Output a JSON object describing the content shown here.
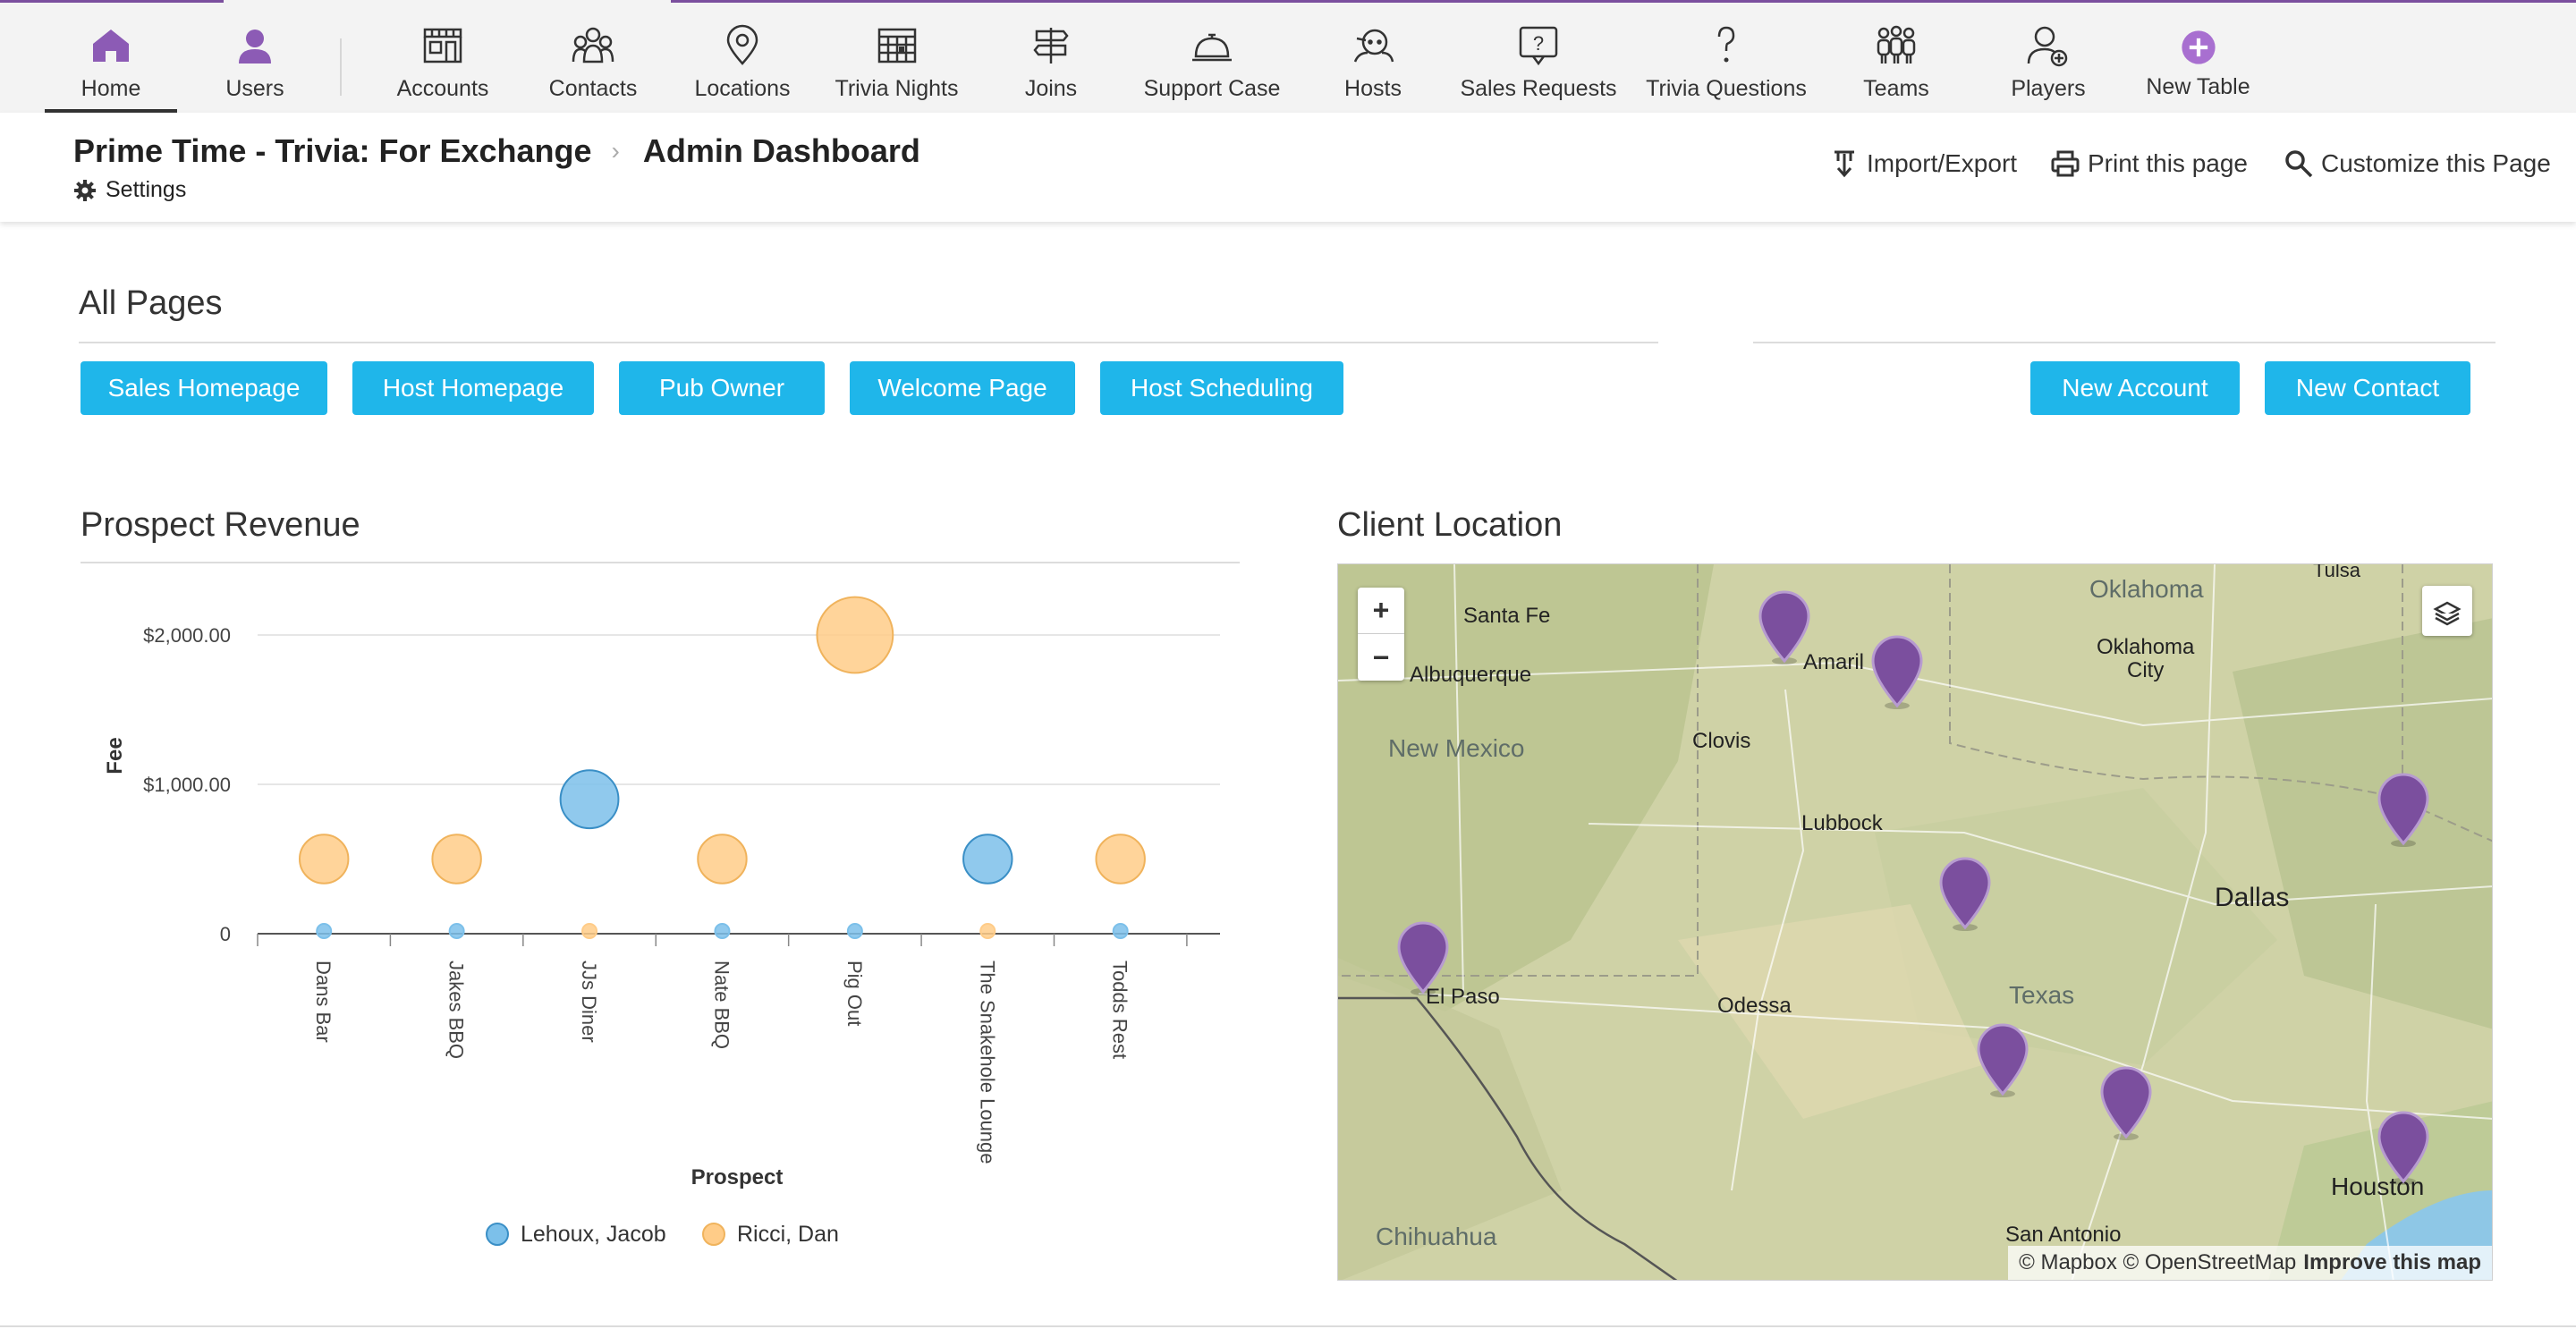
{
  "nav": {
    "items": [
      {
        "label": "Home",
        "icon": "house-icon"
      },
      {
        "label": "Users",
        "icon": "user-icon"
      },
      {
        "label": "Accounts",
        "icon": "storefront-icon"
      },
      {
        "label": "Contacts",
        "icon": "people-icon"
      },
      {
        "label": "Locations",
        "icon": "location-pin-icon"
      },
      {
        "label": "Trivia Nights",
        "icon": "calendar-icon"
      },
      {
        "label": "Joins",
        "icon": "signpost-icon"
      },
      {
        "label": "Support Case",
        "icon": "service-bell-icon"
      },
      {
        "label": "Hosts",
        "icon": "host-face-icon"
      },
      {
        "label": "Sales Requests",
        "icon": "question-bubble-icon"
      },
      {
        "label": "Trivia Questions",
        "icon": "question-mark-icon"
      },
      {
        "label": "Teams",
        "icon": "team-icon"
      },
      {
        "label": "Players",
        "icon": "player-add-icon"
      },
      {
        "label": "New Table",
        "icon": "plus-circle-icon"
      }
    ],
    "accent": "#7b4f9e"
  },
  "header": {
    "app_name": "Prime Time - Trivia: For Exchange",
    "page_name": "Admin Dashboard",
    "settings_label": "Settings",
    "actions": {
      "import_export": "Import/Export",
      "print": "Print this page",
      "customize": "Customize this Page"
    }
  },
  "all_pages": {
    "title": "All Pages",
    "buttons": [
      "Sales Homepage",
      "Host Homepage",
      "Pub Owner",
      "Welcome Page",
      "Host Scheduling"
    ],
    "right_buttons": [
      "New Account",
      "New Contact"
    ],
    "button_color": "#1fb6ea"
  },
  "revenue": {
    "title": "Prospect Revenue"
  },
  "chart_data": {
    "type": "scatter",
    "title": "Prospect Revenue",
    "xlabel": "Prospect",
    "ylabel": "Fee",
    "categories": [
      "Dans Bar",
      "Jakes BBQ",
      "JJs Diner",
      "Nate BBQ",
      "Pig Out",
      "The Snakehole Lounge",
      "Todds Rest"
    ],
    "yticks": [
      "0",
      "$1,000.00",
      "$2,000.00"
    ],
    "ylim": [
      0,
      2000
    ],
    "grid": true,
    "legend_position": "bottom",
    "series": [
      {
        "name": "Lehoux, Jacob",
        "color": "#7cc0ea",
        "values": [
          0,
          0,
          900,
          0,
          0,
          500,
          0
        ]
      },
      {
        "name": "Ricci, Dan",
        "color": "#ffcc88",
        "values": [
          500,
          500,
          0,
          500,
          2000,
          0,
          500
        ]
      }
    ]
  },
  "location": {
    "title": "Client Location",
    "zoom_in": "+",
    "zoom_out": "−",
    "labels": {
      "oklahoma": "Oklahoma",
      "tulsa": "Tulsa",
      "santa_fe": "Santa Fe",
      "albuquerque": "Albuquerque",
      "amarillo": "Amaril",
      "oklahoma_city_1": "Oklahoma",
      "oklahoma_city_2": "City",
      "clovis": "Clovis",
      "new_mexico": "New Mexico",
      "lubbock": "Lubbock",
      "dallas": "Dallas",
      "el_paso": "El Paso",
      "odessa": "Odessa",
      "texas": "Texas",
      "houston": "Houston",
      "chihuahua": "Chihuahua",
      "san_antonio": "San Antonio"
    },
    "attribution": "© Mapbox © OpenStreetMap",
    "improve": "Improve this map",
    "pin_color": "#7b4f9e"
  }
}
